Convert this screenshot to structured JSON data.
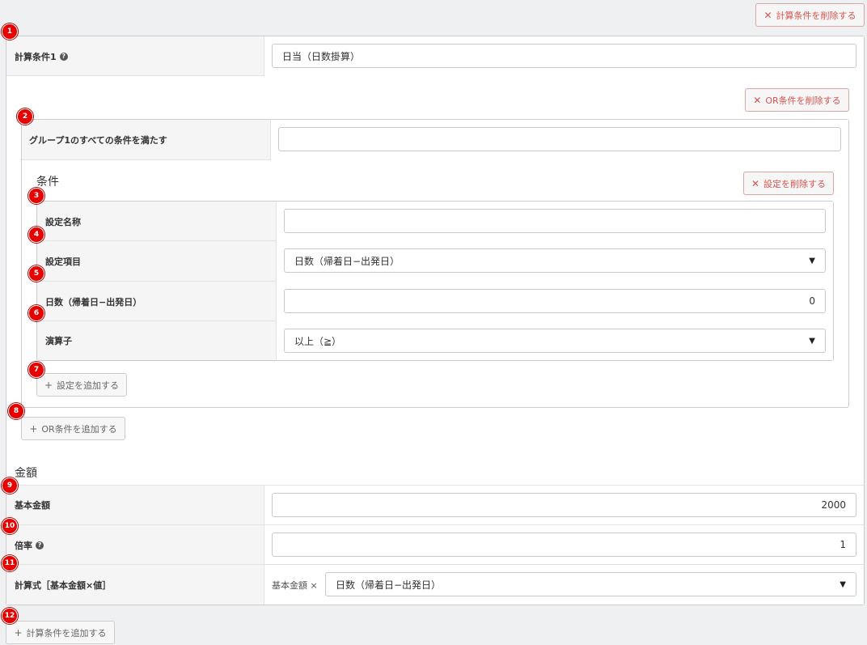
{
  "buttons": {
    "delete_calc": "計算条件を削除する",
    "delete_or": "OR条件を削除する",
    "delete_setting": "設定を削除する",
    "add_setting": "設定を追加する",
    "add_or": "OR条件を追加する",
    "add_calc": "計算条件を追加する",
    "delete_icon": "✕",
    "add_icon": "+"
  },
  "calc": {
    "label": "計算条件1",
    "value": "日当（日数掛算）"
  },
  "group": {
    "label": "グループ1のすべての条件を満たす",
    "value": ""
  },
  "conditions": {
    "heading": "条件",
    "name_label": "設定名称",
    "name_value": "",
    "item_label": "設定項目",
    "item_value": "日数（帰着日−出発日）",
    "days_label": "日数（帰着日−出発日）",
    "days_value": "0",
    "op_label": "演算子",
    "op_value": "以上（≧）"
  },
  "amount": {
    "heading": "金額",
    "base_label": "基本金額",
    "base_value": "2000",
    "rate_label": "倍率",
    "rate_value": "1",
    "formula_label": "計算式［基本金額×値］",
    "formula_prefix": "基本金額 ×",
    "formula_value": "日数（帰着日−出発日）"
  },
  "badges": [
    "1",
    "2",
    "3",
    "4",
    "5",
    "6",
    "7",
    "8",
    "9",
    "10",
    "11",
    "12"
  ],
  "colors": {
    "badge": "#e60000",
    "delete_text": "#d9534f"
  }
}
